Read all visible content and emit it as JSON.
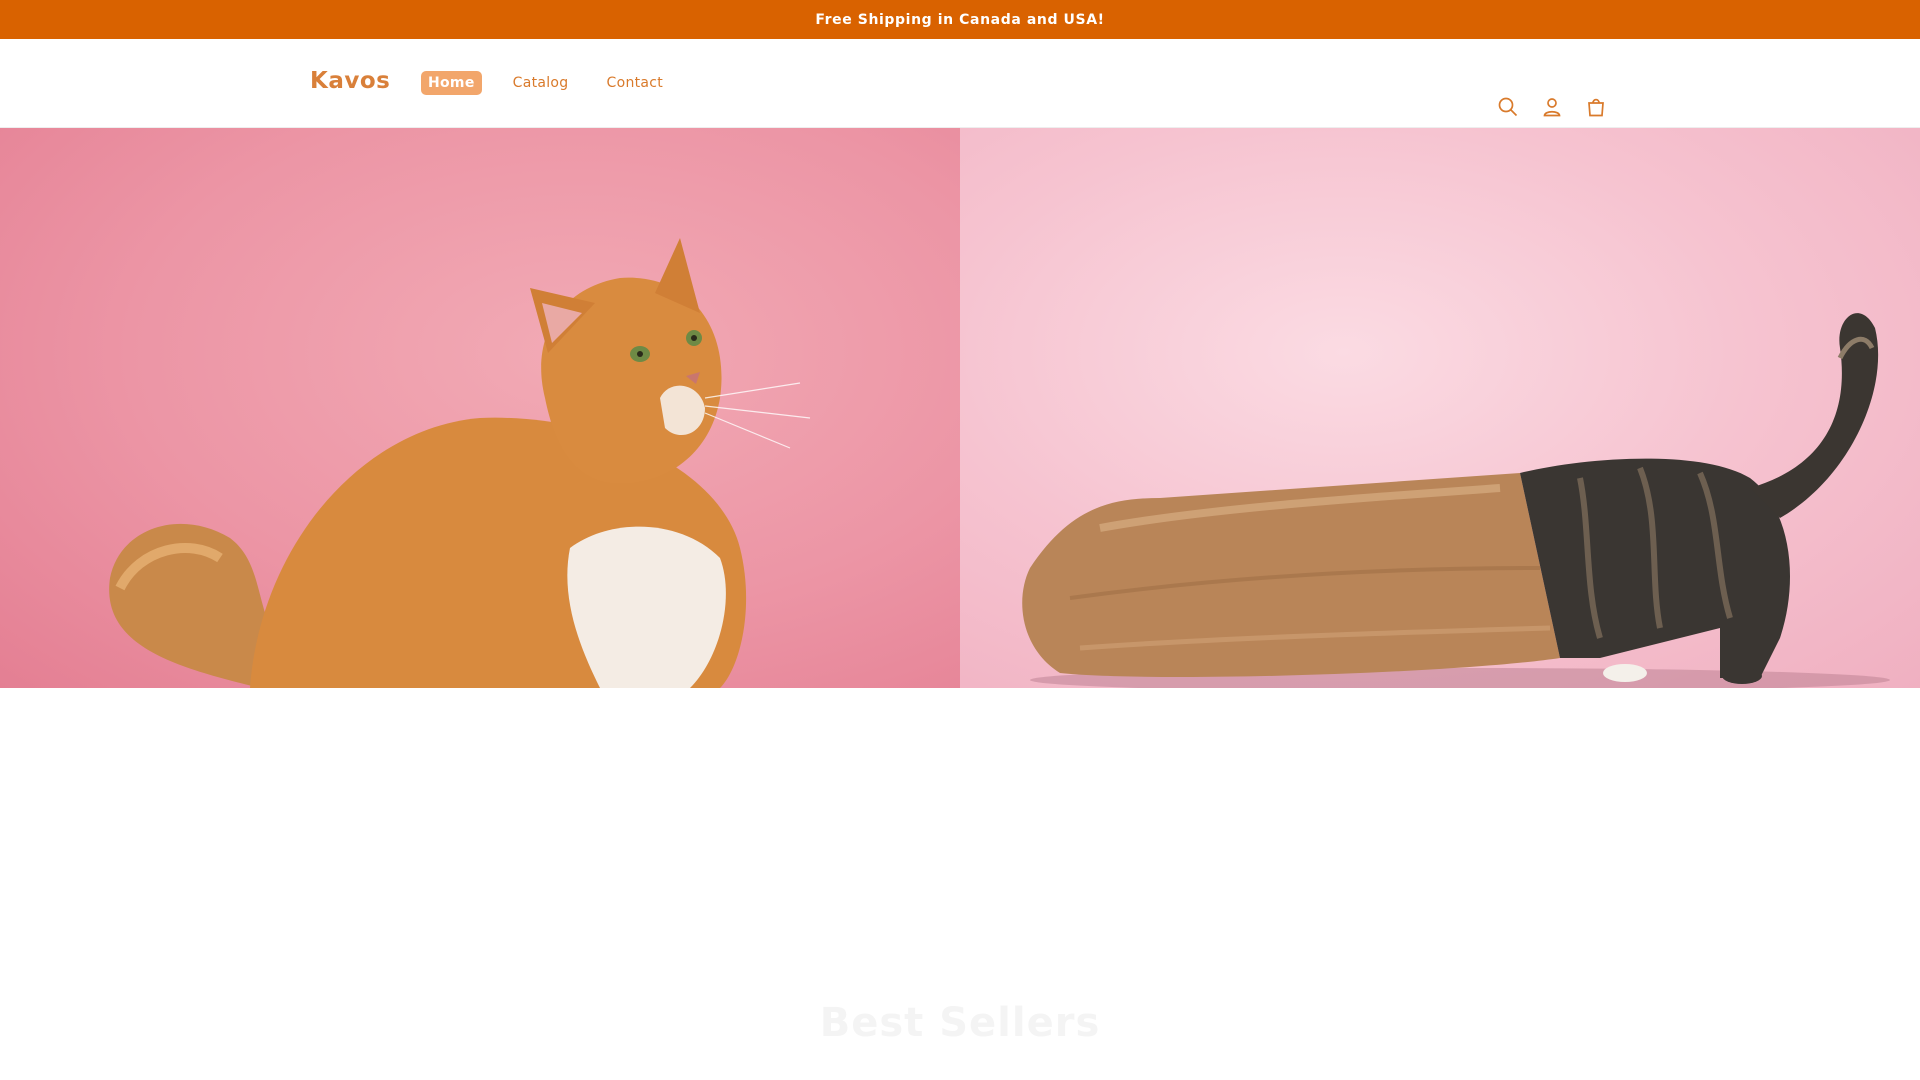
{
  "announcement": {
    "text": "Free Shipping in Canada and USA!"
  },
  "header": {
    "logo": "Kavos",
    "nav": [
      {
        "label": "Home",
        "active": true
      },
      {
        "label": "Catalog",
        "active": false
      },
      {
        "label": "Contact",
        "active": false
      }
    ],
    "icons": [
      "search-icon",
      "account-icon",
      "cart-icon"
    ]
  },
  "hero": {
    "images": [
      "orange-cat-image",
      "cat-in-paper-bag-image"
    ]
  },
  "section": {
    "title": "Best Sellers"
  },
  "colors": {
    "accent": "#d96200",
    "brand_text": "#d9803a",
    "nav_active_bg": "#f2a66b",
    "hero_left_bg": "#ec95a5",
    "hero_right_bg": "#f6c3d0"
  }
}
